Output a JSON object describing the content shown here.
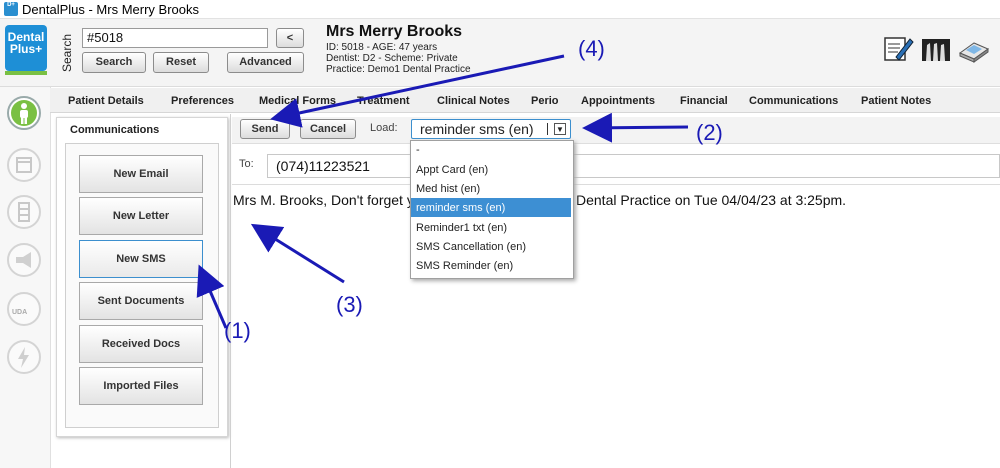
{
  "window": {
    "title": "DentalPlus - Mrs Merry Brooks"
  },
  "logo": {
    "line1": "Dental",
    "line2": "Plus+"
  },
  "search": {
    "label": "Search",
    "value": "#5018",
    "back_label": "<",
    "search_btn": "Search",
    "reset_btn": "Reset",
    "advanced_btn": "Advanced"
  },
  "patient": {
    "name": "Mrs Merry Brooks",
    "id_age": "ID: 5018 - AGE: 47 years",
    "dentist": "Dentist: D2 - Scheme: Private",
    "practice": "Practice: Demo1 Dental Practice"
  },
  "header_icons": [
    "edit-notes-icon",
    "xray-icon",
    "scanner-icon"
  ],
  "rail_icons": [
    "patient-person-icon",
    "calendar-icon",
    "filing-cabinet-icon",
    "megaphone-icon",
    "uda-gauge-icon",
    "lightning-icon"
  ],
  "rail_uda_label": "UDA",
  "tabs": [
    "Patient Details",
    "Preferences",
    "Medical Forms",
    "Treatment",
    "Clinical Notes",
    "Perio",
    "Appointments",
    "Financial",
    "Communications",
    "Patient Notes"
  ],
  "side": {
    "heading": "Communications",
    "buttons": [
      "New Email",
      "New Letter",
      "New SMS",
      "Sent Documents",
      "Received Docs",
      "Imported Files"
    ],
    "active_index": 2
  },
  "actions": {
    "send": "Send",
    "cancel": "Cancel",
    "load_label": "Load:",
    "load_value": "reminder sms (en)",
    "select_arrow": "▼"
  },
  "dropdown": {
    "options": [
      "-",
      "Appt Card (en)",
      "Med hist (en)",
      "reminder sms (en)",
      "Reminder1 txt (en)",
      "SMS Cancellation (en)",
      "SMS Reminder (en)"
    ],
    "selected_index": 3
  },
  "message": {
    "to_label": "To:",
    "to_value": "(074)11223521",
    "text_start": "Mrs M. Brooks, Don't forget y",
    "text_end": "Dental Practice on Tue 04/04/23 at 3:25pm."
  },
  "annotations": [
    "(1)",
    "(2)",
    "(3)",
    "(4)"
  ],
  "colors": {
    "accent_blue": "#3d8fd3",
    "annotation_blue": "#1a1ab5",
    "logo_blue": "#1e8fd6",
    "logo_green": "#7ac043"
  }
}
